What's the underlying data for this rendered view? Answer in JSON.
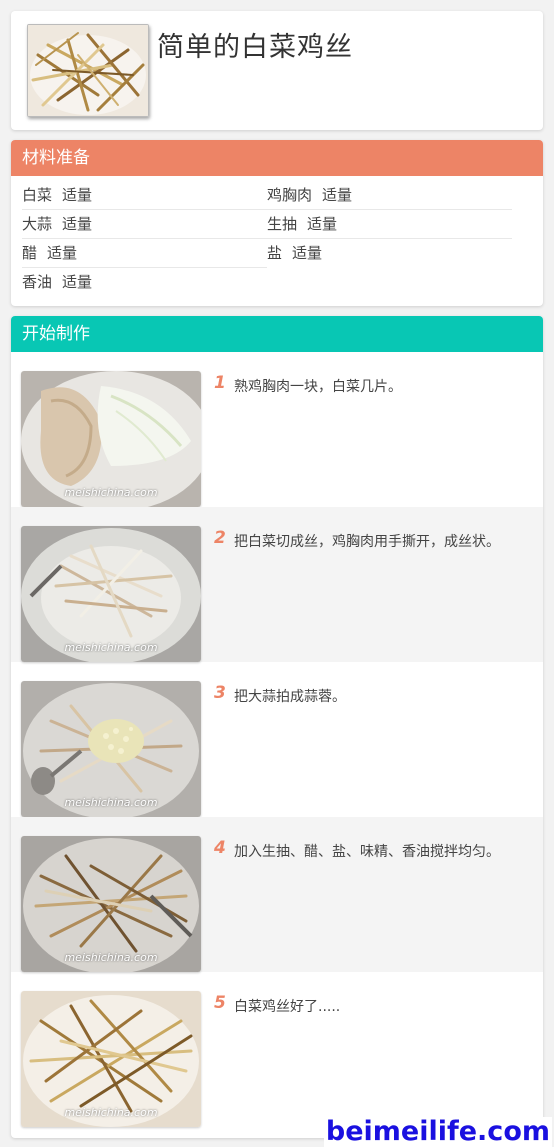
{
  "header": {
    "title": "简单的白菜鸡丝",
    "thumb_icon": "shredded-chicken-cabbage-photo"
  },
  "ingredients": {
    "section_title": "材料准备",
    "items": [
      {
        "name": "白菜",
        "amount": "适量"
      },
      {
        "name": "鸡胸肉",
        "amount": "适量"
      },
      {
        "name": "大蒜",
        "amount": "适量"
      },
      {
        "name": "生抽",
        "amount": "适量"
      },
      {
        "name": "醋",
        "amount": "适量"
      },
      {
        "name": "盐",
        "amount": "适量"
      },
      {
        "name": "香油",
        "amount": "适量"
      }
    ]
  },
  "steps": {
    "section_title": "开始制作",
    "watermark": "meishichina.com",
    "items": [
      {
        "num": "1",
        "text": "熟鸡胸肉一块，白菜几片。"
      },
      {
        "num": "2",
        "text": "把白菜切成丝，鸡胸肉用手撕开，成丝状。"
      },
      {
        "num": "3",
        "text": "把大蒜拍成蒜蓉。"
      },
      {
        "num": "4",
        "text": "加入生抽、醋、盐、味精、香油搅拌均匀。"
      },
      {
        "num": "5",
        "text": "白菜鸡丝好了....."
      }
    ]
  },
  "footer": {
    "site_watermark": "beimeilife.com"
  },
  "colors": {
    "accent_orange": "#ed8466",
    "accent_teal": "#08c7b4",
    "watermark_blue": "#1a10e0"
  }
}
